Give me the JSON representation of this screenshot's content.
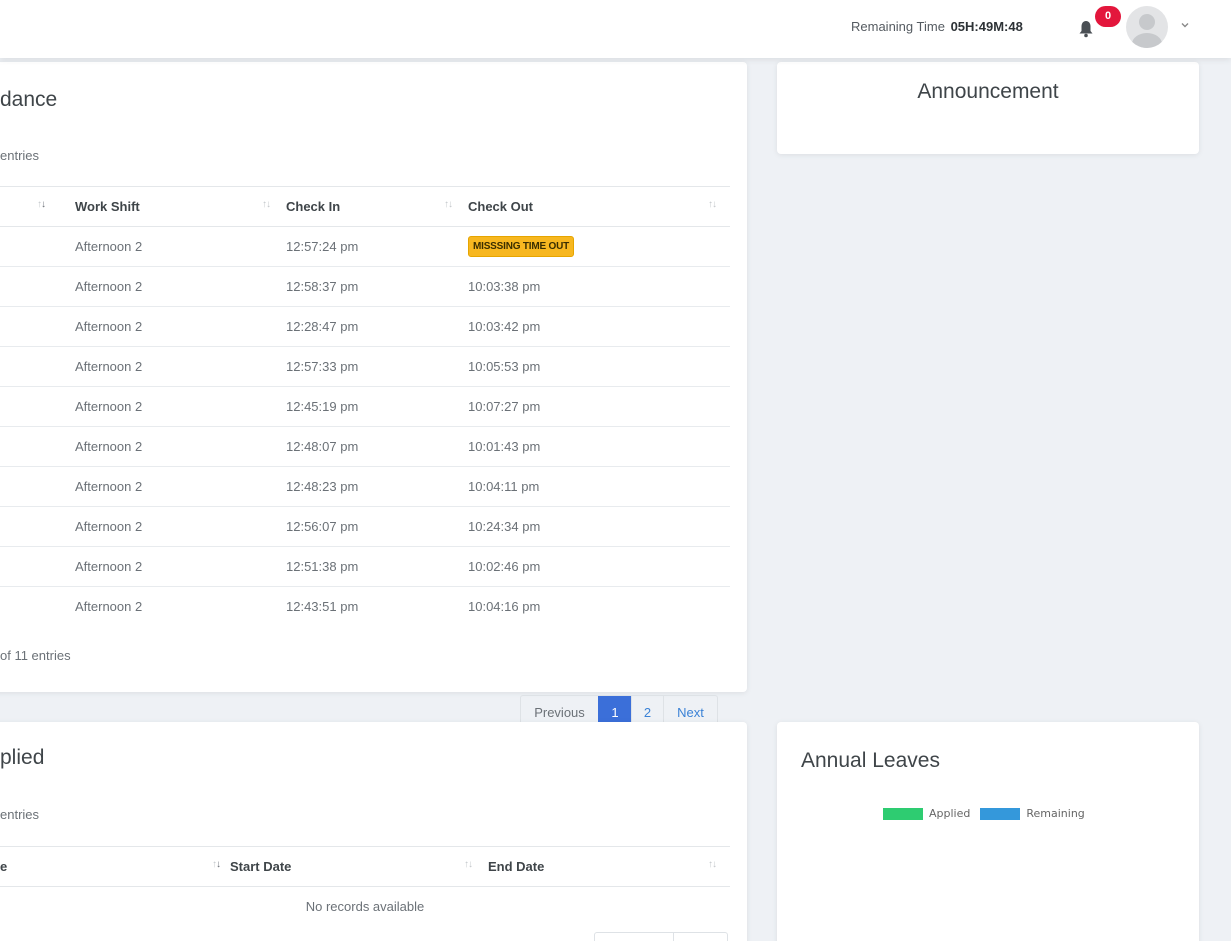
{
  "topbar": {
    "remaining_label": "Remaining Time",
    "remaining_value": "05H:49M:48",
    "notification_count": "0"
  },
  "attendance": {
    "title": "dance",
    "entries_label": "entries",
    "columns": [
      "Work Shift",
      "Check In",
      "Check Out"
    ],
    "rows": [
      {
        "shift": "Afternoon 2",
        "check_in": "12:57:24 pm",
        "check_out": "MISSSING TIME OUT",
        "missing": true
      },
      {
        "shift": "Afternoon 2",
        "check_in": "12:58:37 pm",
        "check_out": "10:03:38 pm"
      },
      {
        "shift": "Afternoon 2",
        "check_in": "12:28:47 pm",
        "check_out": "10:03:42 pm"
      },
      {
        "shift": "Afternoon 2",
        "check_in": "12:57:33 pm",
        "check_out": "10:05:53 pm"
      },
      {
        "shift": "Afternoon 2",
        "check_in": "12:45:19 pm",
        "check_out": "10:07:27 pm"
      },
      {
        "shift": "Afternoon 2",
        "check_in": "12:48:07 pm",
        "check_out": "10:01:43 pm"
      },
      {
        "shift": "Afternoon 2",
        "check_in": "12:48:23 pm",
        "check_out": "10:04:11 pm"
      },
      {
        "shift": "Afternoon 2",
        "check_in": "12:56:07 pm",
        "check_out": "10:24:34 pm"
      },
      {
        "shift": "Afternoon 2",
        "check_in": "12:51:38 pm",
        "check_out": "10:02:46 pm"
      },
      {
        "shift": "Afternoon 2",
        "check_in": "12:43:51 pm",
        "check_out": "10:04:16 pm"
      }
    ],
    "footer_info": "of 11 entries",
    "pager": {
      "previous": "Previous",
      "pages": [
        "1",
        "2"
      ],
      "next": "Next",
      "active": "1"
    }
  },
  "announcement": {
    "title": "Announcement"
  },
  "leaves": {
    "title": "plied",
    "entries_label": "entries",
    "columns": [
      "e",
      "Start Date",
      "End Date"
    ],
    "empty_text": "No records available"
  },
  "annual_leaves": {
    "title": "Annual Leaves",
    "legend": [
      {
        "label": "Applied",
        "color": "#2ecc71"
      },
      {
        "label": "Remaining",
        "color": "#3498db"
      }
    ]
  },
  "colors": {
    "accent": "#3b6fd9",
    "badge_warning": "#f7b720",
    "notification": "#e3163c"
  }
}
